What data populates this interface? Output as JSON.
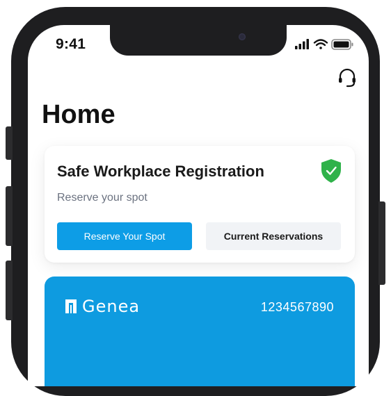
{
  "status_bar": {
    "time": "9:41",
    "icons": [
      "signal-icon",
      "wifi-icon",
      "battery-icon"
    ]
  },
  "header": {
    "support_icon": "headset-icon"
  },
  "page": {
    "title": "Home"
  },
  "registration_card": {
    "title": "Safe Workplace Registration",
    "subtitle": "Reserve your spot",
    "status_icon": "shield-check-icon",
    "status_color": "#2fb24a",
    "primary_button": "Reserve Your Spot",
    "secondary_button": "Current Reservations"
  },
  "id_card": {
    "brand": "Genea",
    "number": "1234567890",
    "color": "#0e9be0"
  },
  "colors": {
    "accent": "#0d9de6",
    "secondary_bg": "#f1f3f6"
  }
}
